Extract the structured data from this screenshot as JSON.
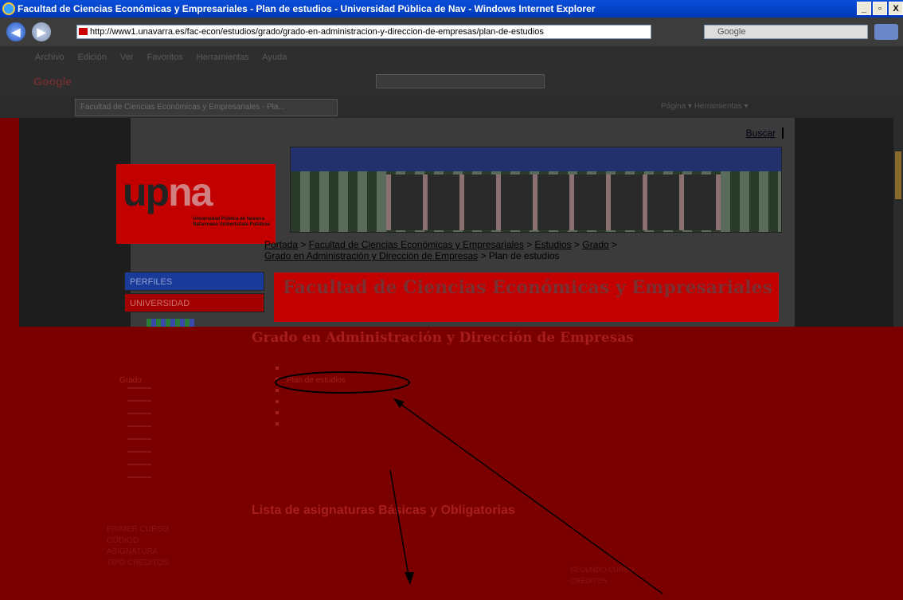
{
  "window": {
    "title": "Facultad de Ciencias Económicas y Empresariales - Plan de estudios - Universidad Pública de Nav - Windows Internet Explorer",
    "minimize": "_",
    "maximize": "▫",
    "close": "X"
  },
  "address": {
    "url": "http://www1.unavarra.es/fac-econ/estudios/grado/grado-en-administracion-y-direccion-de-empresas/plan-de-estudios",
    "search_placeholder": "Google"
  },
  "menubar": {
    "items": [
      "Archivo",
      "Edición",
      "Ver",
      "Favoritos",
      "Herramientas",
      "Ayuda"
    ]
  },
  "google_toolbar": {
    "logo": "Google"
  },
  "tab": {
    "label": "Facultad de Ciencias Económicas y Empresariales - Pla...",
    "tools": "Página ▾   Herramientas ▾"
  },
  "page": {
    "buscar": "Buscar",
    "logo_main": "up",
    "logo_accent": "na",
    "logo_sub": "Universidad Pública de Navarra Nafarroako Unibertsitate Publikoa",
    "breadcrumb": {
      "portada": "Portada",
      "sep": " > ",
      "facultad": "Facultad de Ciencias Económicas y Empresariales",
      "estudios": "Estudios",
      "grado": "Grado",
      "grado_adm": "Grado en Administración y Dirección de Empresas",
      "current": "Plan de estudios"
    },
    "side": {
      "perfiles": "PERFILES",
      "universidad": "UNIVERSIDAD"
    },
    "faculty_title": "Facultad de Ciencias Económicas y Empresariales",
    "degree_title": "Grado en Administración y Dirección de Empresas",
    "plan_link": "Plan de estudios",
    "grado_label": "Grado",
    "lista_title": "Lista de asignaturas Básicas y Obligatorias",
    "left_col": [
      "PRIMER CURSO",
      "CÓDIGO",
      "ASIGNATURA",
      "TIPO CRÉDITOS"
    ],
    "right_col": [
      "SEGUNDO CURSO",
      "CRÉDITOS"
    ]
  }
}
